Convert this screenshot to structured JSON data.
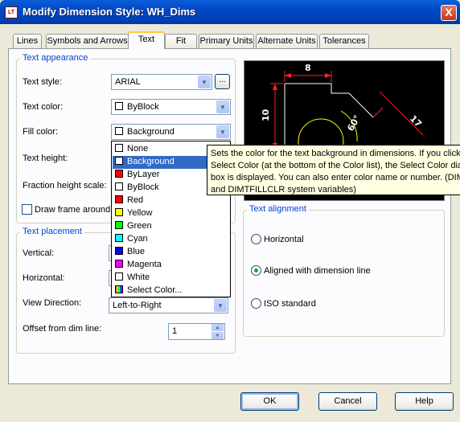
{
  "window": {
    "title": "Modify Dimension Style: WH_Dims",
    "close_glyph": "X",
    "app_icon_text": "LT"
  },
  "tabs": [
    "Lines",
    "Symbols and Arrows",
    "Text",
    "Fit",
    "Primary Units",
    "Alternate Units",
    "Tolerances"
  ],
  "active_tab": "Text",
  "text_appearance": {
    "title": "Text appearance",
    "style_label": "Text style:",
    "style_value": "ARIAL",
    "browse_label": "...",
    "color_label": "Text color:",
    "color_value": "ByBlock",
    "fill_label": "Fill color:",
    "fill_value": "Background",
    "height_label": "Text height:",
    "fraction_label": "Fraction height scale:",
    "frame_label": "Draw frame around t"
  },
  "fill_dropdown": {
    "items": [
      {
        "label": "None",
        "color": "#ffffff"
      },
      {
        "label": "Background",
        "color": "#ffffff"
      },
      {
        "label": "ByLayer",
        "color": "#ff0000"
      },
      {
        "label": "ByBlock",
        "color": "#ffffff"
      },
      {
        "label": "Red",
        "color": "#ff0000"
      },
      {
        "label": "Yellow",
        "color": "#ffff00"
      },
      {
        "label": "Green",
        "color": "#00ff00"
      },
      {
        "label": "Cyan",
        "color": "#00ffff"
      },
      {
        "label": "Blue",
        "color": "#0000ff"
      },
      {
        "label": "Magenta",
        "color": "#ff00ff"
      },
      {
        "label": "White",
        "color": "#ffffff"
      },
      {
        "label": "Select Color...",
        "color": "gradient"
      }
    ],
    "selected": "Background"
  },
  "tooltip": {
    "lines": [
      "Sets the color for the text background in dimensions. If you click",
      "Select Color (at the bottom of the Color list), the Select Color dia",
      "box is displayed. You can also enter color name or number. (DIM",
      "and DIMTFILLCLR system variables)"
    ]
  },
  "preview": {
    "dim_top": "8",
    "dim_left": "10",
    "dim_diag": "17",
    "dim_angle": "60°"
  },
  "text_alignment": {
    "title": "Text alignment",
    "options": [
      "Horizontal",
      "Aligned with dimension line",
      "ISO standard"
    ],
    "selected": "Aligned with dimension line"
  },
  "text_placement": {
    "title": "Text placement",
    "vertical_label": "Vertical:",
    "horizontal_label": "Horizontal:",
    "view_direction_label": "View Direction:",
    "view_direction_value": "Left-to-Right",
    "offset_label": "Offset from dim line:",
    "offset_value": "1"
  },
  "buttons": {
    "ok": "OK",
    "cancel": "Cancel",
    "help": "Help"
  },
  "colors": {
    "title_bar": "#0247c5",
    "group_title": "#0046d5",
    "selection": "#316ac5",
    "tab_highlight": "#ffc83c"
  }
}
